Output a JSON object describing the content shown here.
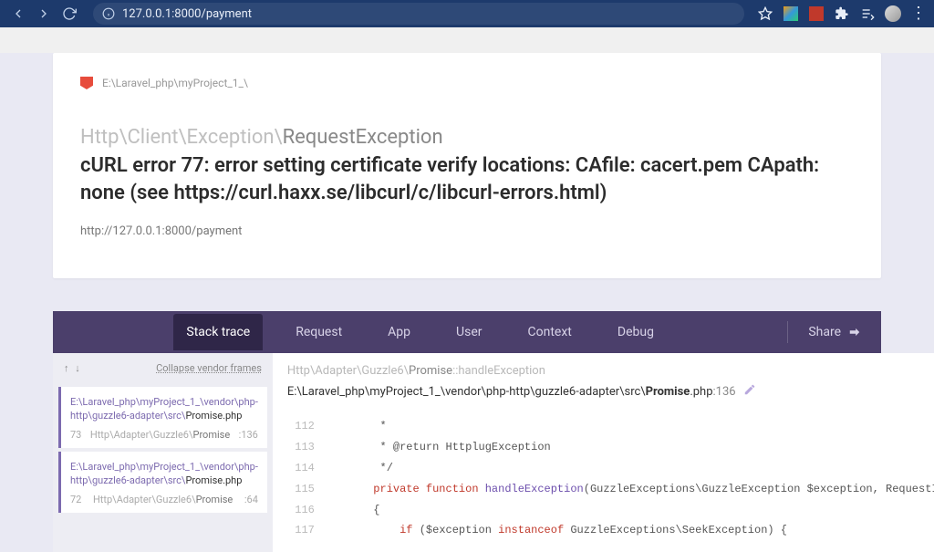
{
  "browser": {
    "url": "127.0.0.1:8000/payment"
  },
  "card": {
    "project_path": "E:\\Laravel_php\\myProject_1_\\",
    "exception_ns_prefix": "Http\\Client\\Exception\\",
    "exception_ns_last": "RequestException",
    "message": "cURL error 77: error setting certificate verify locations: CAfile: cacert.pem CApath: none (see https://curl.haxx.se/libcurl/c/libcurl-errors.html)",
    "request_url": "http://127.0.0.1:8000/payment"
  },
  "tabs": {
    "stack": "Stack trace",
    "request": "Request",
    "app": "App",
    "user": "User",
    "context": "Context",
    "debug": "Debug",
    "share": "Share"
  },
  "frames_left": {
    "collapse": "Collapse vendor frames",
    "items": [
      {
        "number": "73",
        "path_dir": "E:\\Laravel_php\\myProject_1_\\vendor\\php-http\\guzzle6-adapter\\src\\",
        "path_file": "Promise.php",
        "sub_ns": "Http\\Adapter\\Guzzle6\\",
        "sub_cls": "Promise",
        "line": ":136"
      },
      {
        "number": "72",
        "path_dir": "E:\\Laravel_php\\myProject_1_\\vendor\\php-http\\guzzle6-adapter\\src\\",
        "path_file": "Promise.php",
        "sub_ns": "Http\\Adapter\\Guzzle6\\",
        "sub_cls": "Promise",
        "line": ":64"
      }
    ]
  },
  "frames_right": {
    "ns_prefix": "Http\\Adapter\\Guzzle6\\",
    "ns_cls": "Promise",
    "ns_method": "::handleException",
    "file_path": "E:\\Laravel_php\\myProject_1_\\vendor\\php-http\\guzzle6-adapter\\src\\",
    "file_name": "Promise",
    "file_ext": ".php",
    "file_line": ":136",
    "code": [
      {
        "n": "112",
        "t": "        *"
      },
      {
        "n": "113",
        "t": "        * @return HttplugException"
      },
      {
        "n": "114",
        "t": "        */"
      },
      {
        "n": "115",
        "t": "       private function handleException(GuzzleExceptions\\GuzzleException $exception, RequestInterface $request)"
      },
      {
        "n": "116",
        "t": "       {"
      },
      {
        "n": "117",
        "t": "           if ($exception instanceof GuzzleExceptions\\SeekException) {"
      }
    ]
  }
}
